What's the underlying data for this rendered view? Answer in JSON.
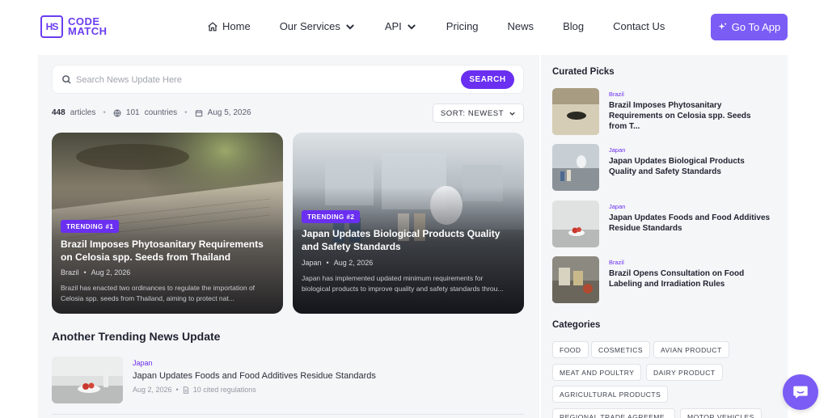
{
  "logo": {
    "mark": "HS",
    "line1": "CODE",
    "line2": "MATCH"
  },
  "nav": {
    "home": "Home",
    "services": "Our Services",
    "api": "API",
    "pricing": "Pricing",
    "news": "News",
    "blog": "Blog",
    "contact": "Contact Us"
  },
  "go_to_app": "Go To App",
  "search": {
    "placeholder": "Search News Update Here",
    "button": "SEARCH"
  },
  "stats": {
    "articles_count": "448",
    "articles_label": "articles",
    "countries_count": "101",
    "countries_label": "countries",
    "date": "Aug 5, 2026"
  },
  "sort": {
    "label": "SORT: NEWEST"
  },
  "trending": [
    {
      "badge": "TRENDING #1",
      "title": "Brazil Imposes Phytosanitary Requirements on Celosia spp. Seeds from Thailand",
      "country": "Brazil",
      "date": "Aug 2, 2026",
      "excerpt": "Brazil has enacted two ordinances to regulate the importation of Celosia spp. seeds from Thailand, aiming to protect nat..."
    },
    {
      "badge": "TRENDING #2",
      "title": "Japan Updates Biological Products Quality and Safety Standards",
      "country": "Japan",
      "date": "Aug 2, 2026",
      "excerpt": "Japan has implemented updated minimum requirements for biological products to improve quality and safety standards throu..."
    }
  ],
  "another_section": {
    "title": "Another Trending News Update",
    "item": {
      "country": "Japan",
      "title": "Japan Updates Foods and Food Additives Residue Standards",
      "date": "Aug 2, 2026",
      "cited": "10 cited regulations"
    }
  },
  "curated": {
    "title": "Curated Picks",
    "items": [
      {
        "country": "Brazil",
        "title": "Brazil Imposes Phytosanitary Requirements on Celosia spp. Seeds from T..."
      },
      {
        "country": "Japan",
        "title": "Japan Updates Biological Products Quality and Safety Standards"
      },
      {
        "country": "Japan",
        "title": "Japan Updates Foods and Food Additives Residue Standards"
      },
      {
        "country": "Brazil",
        "title": "Brazil Opens Consultation on Food Labeling and Irradiation Rules"
      }
    ]
  },
  "categories": {
    "title": "Categories",
    "chips": [
      "FOOD",
      "COSMETICS",
      "AVIAN PRODUCT",
      "MEAT AND POULTRY",
      "DAIRY PRODUCT",
      "AGRICULTURAL PRODUCTS",
      "REGIONAL TRADE AGREEME...",
      "MOTOR VEHICLES"
    ]
  },
  "colors": {
    "accent": "#6a2ff0",
    "button": "#7b5cf5",
    "panel": "#f5f6f8"
  }
}
